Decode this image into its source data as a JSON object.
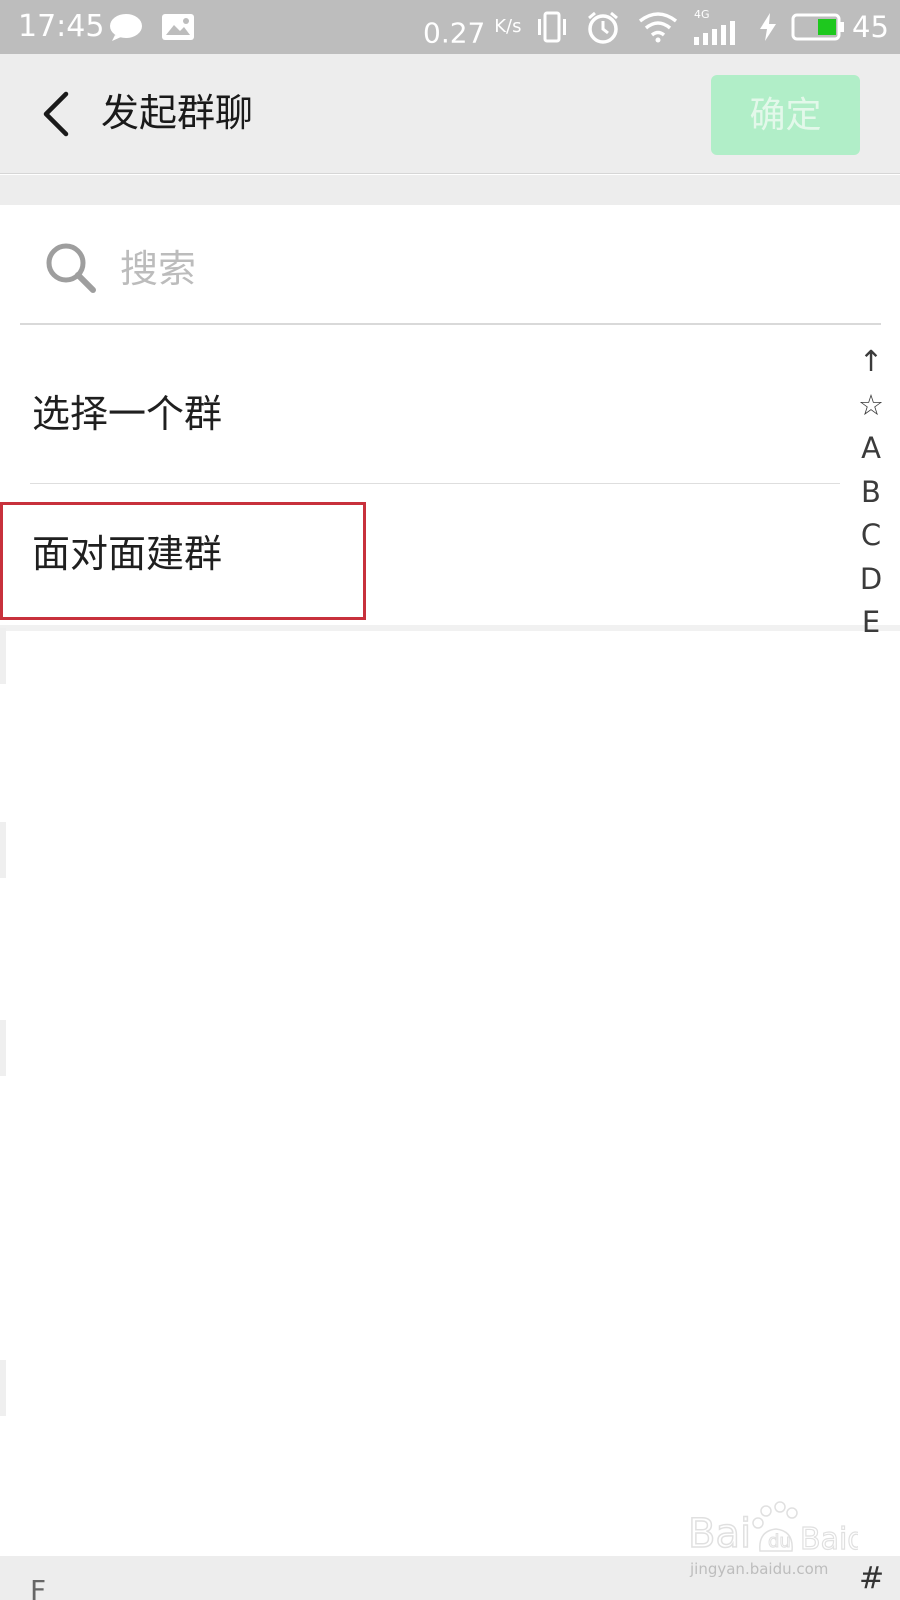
{
  "status_bar": {
    "time": "17:45",
    "network_speed": "0.27",
    "network_speed_unit": "K/s",
    "network_type": "4G",
    "battery_level": "45",
    "battery_color": "#1ec81e",
    "icons": [
      "chat-bubble-icon",
      "image-icon",
      "vibrate-icon",
      "alarm-icon",
      "wifi-icon",
      "signal-icon",
      "charging-icon",
      "battery-icon"
    ]
  },
  "header": {
    "title": "发起群聊",
    "confirm_label": "确定",
    "confirm_enabled": false,
    "accent_color": "#b1eec8"
  },
  "search": {
    "placeholder": "搜索",
    "value": ""
  },
  "options": [
    {
      "label": "选择一个群"
    },
    {
      "label": "面对面建群"
    }
  ],
  "index_bar": [
    "↑",
    "☆",
    "A",
    "B",
    "C",
    "D",
    "E"
  ],
  "bottom": {
    "section_letter": "F",
    "hash_label": "#"
  },
  "watermark": {
    "logo": "Baidu 经验",
    "url": "jingyan.baidu.com"
  }
}
